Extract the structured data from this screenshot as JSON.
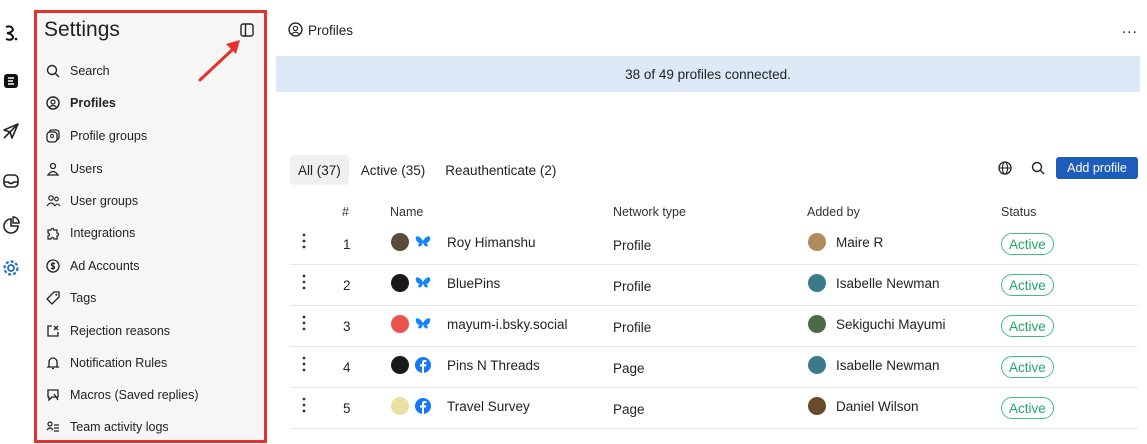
{
  "rail": {
    "icons": [
      "logo-icon",
      "brand-icon",
      "send-icon",
      "inbox-icon",
      "analytics-icon",
      "settings-icon"
    ]
  },
  "sidebar": {
    "title": "Settings",
    "items": [
      {
        "label": "Search",
        "icon": "search-icon",
        "active": false
      },
      {
        "label": "Profiles",
        "icon": "profile-icon",
        "active": true
      },
      {
        "label": "Profile groups",
        "icon": "profile-groups-icon",
        "active": false
      },
      {
        "label": "Users",
        "icon": "user-icon",
        "active": false
      },
      {
        "label": "User groups",
        "icon": "user-groups-icon",
        "active": false
      },
      {
        "label": "Integrations",
        "icon": "integrations-icon",
        "active": false
      },
      {
        "label": "Ad Accounts",
        "icon": "dollar-icon",
        "active": false
      },
      {
        "label": "Tags",
        "icon": "tag-icon",
        "active": false
      },
      {
        "label": "Rejection reasons",
        "icon": "rejection-icon",
        "active": false
      },
      {
        "label": "Notification Rules",
        "icon": "bell-icon",
        "active": false
      },
      {
        "label": "Macros (Saved replies)",
        "icon": "macros-icon",
        "active": false
      },
      {
        "label": "Team activity logs",
        "icon": "activity-icon",
        "active": false
      }
    ]
  },
  "header": {
    "title": "Profiles",
    "more": "..."
  },
  "banner": {
    "text": "38 of 49 profiles connected."
  },
  "tabs": [
    {
      "label": "All (37)",
      "active": true
    },
    {
      "label": "Active (35)",
      "active": false
    },
    {
      "label": "Reauthenticate (2)",
      "active": false
    }
  ],
  "toolbar": {
    "add_label": "Add profile"
  },
  "table": {
    "columns": [
      "#",
      "Name",
      "Network type",
      "Added by",
      "Status"
    ],
    "rows": [
      {
        "num": "1",
        "name": "Roy Himanshu",
        "network": "bluesky",
        "type": "Profile",
        "added_by": "Maire R",
        "status": "Active"
      },
      {
        "num": "2",
        "name": "BluePins",
        "network": "bluesky",
        "type": "Profile",
        "added_by": "Isabelle Newman",
        "status": "Active"
      },
      {
        "num": "3",
        "name": "mayum-i.bsky.social",
        "network": "bluesky",
        "type": "Profile",
        "added_by": "Sekiguchi Mayumi",
        "status": "Active"
      },
      {
        "num": "4",
        "name": "Pins N Threads",
        "network": "facebook",
        "type": "Page",
        "added_by": "Isabelle Newman",
        "status": "Active"
      },
      {
        "num": "5",
        "name": "Travel Survey",
        "network": "facebook",
        "type": "Page",
        "added_by": "Daniel Wilson",
        "status": "Active"
      }
    ]
  },
  "colors": {
    "accent": "#1f5dbd",
    "banner": "#dceaf7",
    "status_green": "#21a866",
    "highlight_red": "#e5312b",
    "bluesky": "#1185fe",
    "facebook": "#1877f2"
  }
}
